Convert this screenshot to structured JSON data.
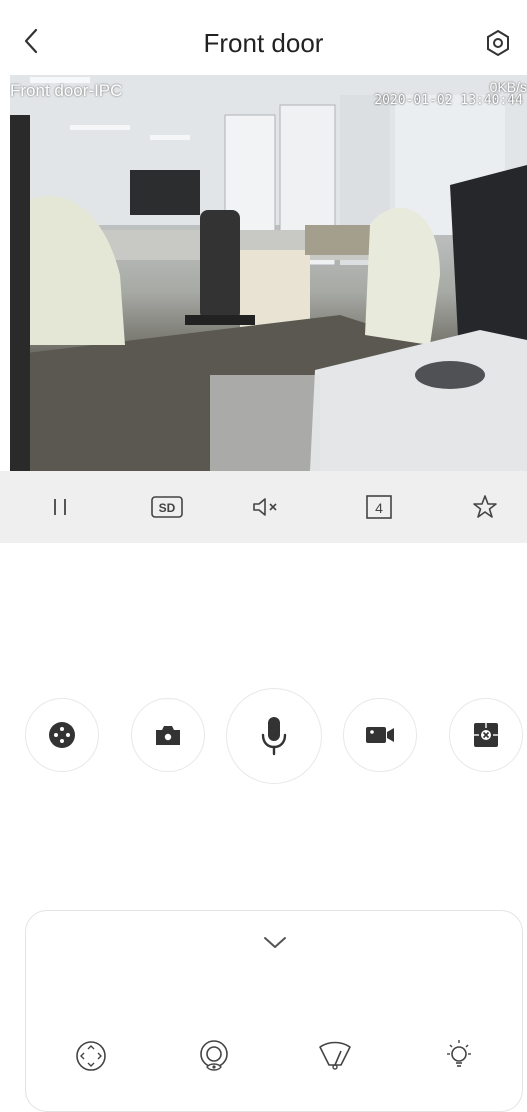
{
  "header": {
    "title": "Front door",
    "back_icon": "chevron-left-icon",
    "settings_icon": "settings-hexagon-icon"
  },
  "video": {
    "camera_label": "Front door-IPC",
    "timestamp": "2020-01-02 13:40:44",
    "bitrate": "0KB/s"
  },
  "controlbar": {
    "items": [
      "pause-icon",
      "sd-quality-icon",
      "mute-icon",
      "split-4-icon",
      "favorite-star-icon"
    ],
    "sd_label": "SD",
    "split_label": "4"
  },
  "actions": {
    "items": [
      "ptz-dpad-icon",
      "snapshot-camera-icon",
      "talk-microphone-icon",
      "record-video-icon",
      "fisheye-close-icon"
    ]
  },
  "panel": {
    "items": [
      "ptz-direction-icon",
      "privacy-eye-icon",
      "wiper-icon",
      "light-bulb-icon"
    ]
  },
  "colors": {
    "accent": "#333333",
    "controlbar_bg": "#efefef",
    "icon_stroke": "#444444"
  }
}
